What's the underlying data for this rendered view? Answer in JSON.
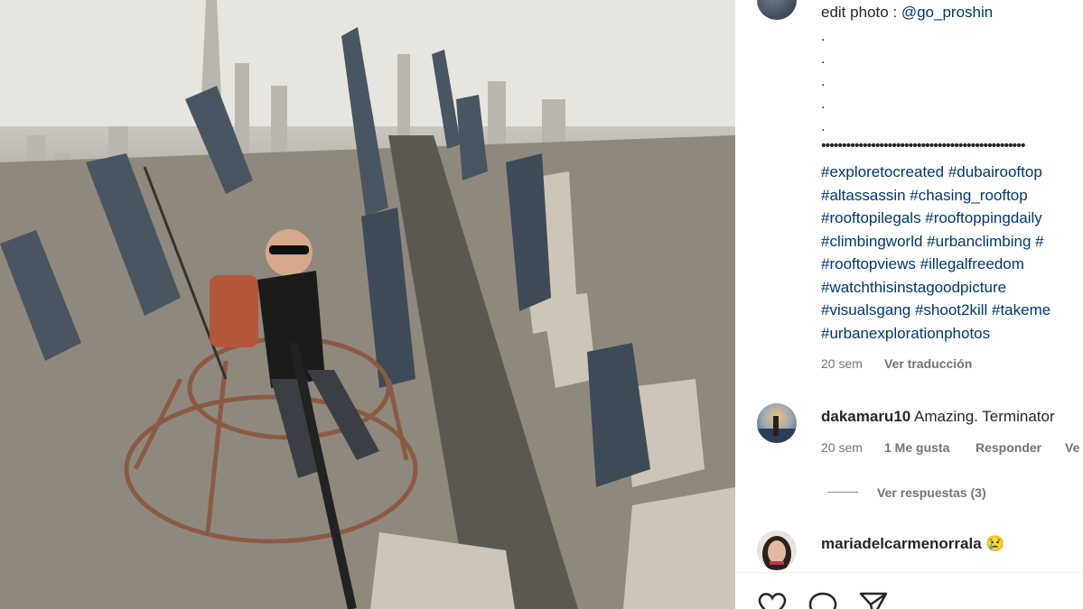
{
  "post": {
    "image_alt_subject": "rooftop selfie over city skyline",
    "caption": {
      "prefix": "edit photo : ",
      "mention": "@go_proshin",
      "dots": [
        ".",
        ".",
        ".",
        ".",
        "."
      ],
      "separator": "•••••••••••••••••••••••••••••••••••••••••••••••••",
      "hashtag_lines": [
        "#exploretocreated #dubairooftop",
        "#altassassin #chasing_rooftop",
        "#rooftopilegals #rooftoppingdaily",
        "#climbingworld #urbanclimbing #",
        "#rooftopviews #illegalfreedom",
        "#watchthisinstagoodpicture",
        "#visualsgang #shoot2kill #takeme",
        "#urbanexplorationphotos"
      ]
    },
    "caption_meta": {
      "time": "20 sem",
      "translate": "Ver traducción"
    }
  },
  "comments": [
    {
      "username": "dakamaru10",
      "text": "Amazing. Terminator",
      "time": "20 sem",
      "likes": "1 Me gusta",
      "reply": "Responder",
      "more": "Ve",
      "view_replies": "Ver respuestas (3)"
    },
    {
      "username": "mariadelcarmenorrala",
      "text": "😢"
    }
  ],
  "actions": [
    "heart-icon",
    "comment-icon",
    "share-icon"
  ],
  "colors": {
    "link": "#00376b",
    "text": "#262626",
    "muted": "#737373"
  }
}
